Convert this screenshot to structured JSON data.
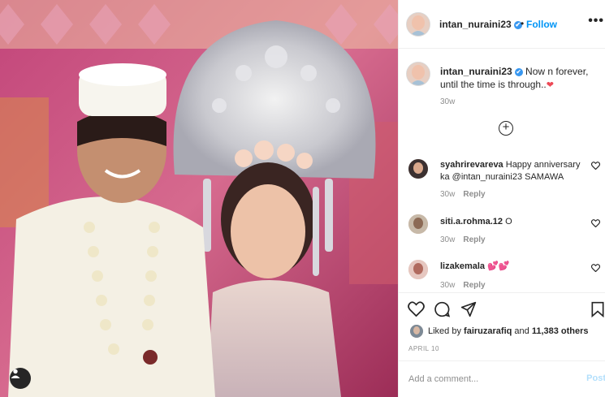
{
  "post": {
    "username": "intan_nuraini23",
    "follow_label": "Follow",
    "more_label": "•••",
    "separator": "•",
    "verified_mark": "✔"
  },
  "caption": {
    "username": "intan_nuraini23",
    "text": "Now n forever, until the time is through..",
    "emoji": "❤",
    "age": "30w"
  },
  "load_more_label": "+",
  "comments": [
    {
      "username": "syahrirevareva",
      "text_line1": "Happy anniversary",
      "text_line2": "ka @intan_nuraini23 SAMAWA",
      "age": "30w",
      "reply_label": "Reply"
    },
    {
      "username": "siti.a.rohma.12",
      "text": "O",
      "age": "30w",
      "reply_label": "Reply"
    },
    {
      "username": "lizakemala",
      "text": "💕💕",
      "age": "30w",
      "reply_label": "Reply"
    }
  ],
  "likes": {
    "prefix": "Liked by",
    "user": "fairuzarafiq",
    "middle": "and",
    "count": "11,383 others"
  },
  "date": "APRIL 10",
  "add_comment": {
    "placeholder": "Add a comment...",
    "post_label": "Post"
  },
  "icons": {
    "like": "heart-icon",
    "comment": "comment-icon",
    "share": "share-icon",
    "save": "bookmark-icon",
    "tags": "user-tag-icon",
    "comment_like": "heart-outline-icon"
  },
  "colors": {
    "link_blue": "#0095f6",
    "muted": "#8e8e8e",
    "post_disabled": "#b2dffc",
    "heart_red": "#ed4956"
  }
}
